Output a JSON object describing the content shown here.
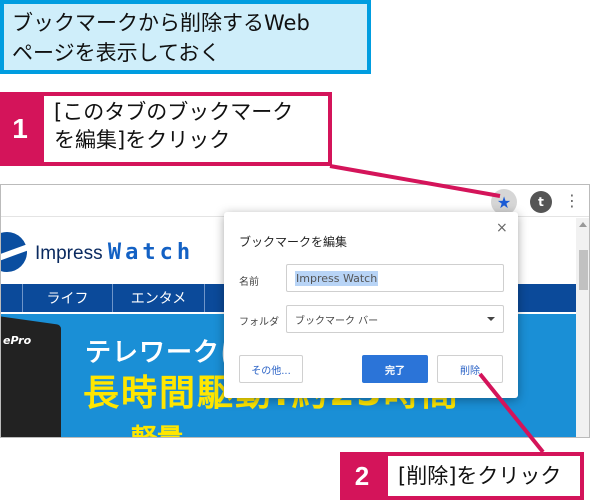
{
  "instruction": {
    "line1": "ブックマークから削除するWeb",
    "line2": "ページを表示しておく"
  },
  "step1": {
    "number": "1",
    "line1": "[このタブのブックマーク",
    "line2": "を編集]をクリック"
  },
  "step2": {
    "number": "2",
    "text": "[削除]をクリック"
  },
  "browser": {
    "toolbar": {
      "star_icon": "★",
      "avatar_letter": "t",
      "menu_icon": "⋮"
    }
  },
  "website": {
    "logo": {
      "impress": "Impress",
      "watch": "Watch"
    },
    "nav": [
      "ライフ",
      "エンタメ"
    ],
    "hero": {
      "laptop_label": "ePro",
      "line1": "テレワークに",
      "line2": "長時間駆動!約23時間",
      "line3": "軽量"
    }
  },
  "dialog": {
    "title": "ブックマークを編集",
    "close": "×",
    "name_label": "名前",
    "name_value": "Impress Watch",
    "folder_label": "フォルダ",
    "folder_value": "ブックマーク バー",
    "more_button": "その他...",
    "done_button": "完了",
    "remove_button": "削除"
  },
  "colors": {
    "accent_magenta": "#d4145a",
    "caption_blue": "#009de0",
    "caption_fill": "#cfeefa",
    "dialog_primary": "#2b74d8"
  }
}
